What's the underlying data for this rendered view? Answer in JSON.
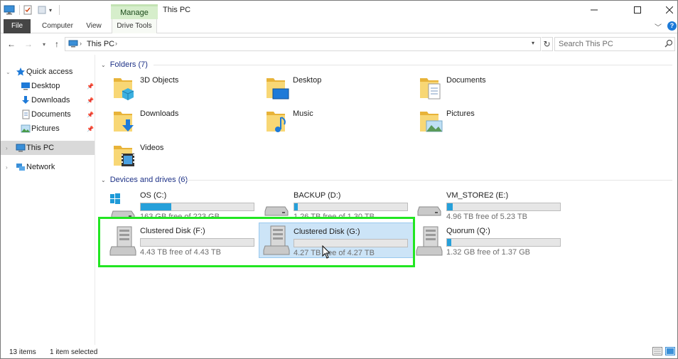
{
  "window": {
    "title": "This PC",
    "manage_tab": "Manage"
  },
  "ribbon": {
    "tabs": [
      "File",
      "Computer",
      "View",
      "Drive Tools"
    ],
    "help": "?"
  },
  "nav": {
    "breadcrumb": [
      "This PC"
    ],
    "search_placeholder": "Search This PC"
  },
  "navpane": {
    "quick_access": "Quick access",
    "quick_items": [
      {
        "label": "Desktop",
        "icon": "desktop-icon"
      },
      {
        "label": "Downloads",
        "icon": "download-icon"
      },
      {
        "label": "Documents",
        "icon": "documents-icon"
      },
      {
        "label": "Pictures",
        "icon": "pictures-icon"
      }
    ],
    "this_pc": "This PC",
    "network": "Network"
  },
  "content": {
    "folders_header": "Folders (7)",
    "folders": [
      {
        "name": "3D Objects",
        "icon": "3d-objects-folder-icon"
      },
      {
        "name": "Desktop",
        "icon": "desktop-folder-icon"
      },
      {
        "name": "Documents",
        "icon": "documents-folder-icon"
      },
      {
        "name": "Downloads",
        "icon": "downloads-folder-icon"
      },
      {
        "name": "Music",
        "icon": "music-folder-icon"
      },
      {
        "name": "Pictures",
        "icon": "pictures-folder-icon"
      },
      {
        "name": "Videos",
        "icon": "videos-folder-icon"
      }
    ],
    "drives_header": "Devices and drives (6)",
    "drives": [
      {
        "name": "OS (C:)",
        "free": "163 GB free of 223 GB",
        "used_fraction": 0.27,
        "icon": "windows-drive-icon"
      },
      {
        "name": "BACKUP (D:)",
        "free": "1.26 TB free of 1.30 TB",
        "used_fraction": 0.03,
        "icon": "hard-drive-icon"
      },
      {
        "name": "VM_STORE2 (E:)",
        "free": "4.96 TB free of 5.23 TB",
        "used_fraction": 0.05,
        "icon": "hard-drive-icon"
      },
      {
        "name": "Clustered Disk (F:)",
        "free": "4.43 TB free of 4.43 TB",
        "used_fraction": 0.0,
        "icon": "server-drive-icon"
      },
      {
        "name": "Clustered Disk (G:)",
        "free": "4.27 TB free of 4.27 TB",
        "used_fraction": 0.0,
        "icon": "server-drive-icon"
      },
      {
        "name": "Quorum (Q:)",
        "free": "1.32 GB free of 1.37 GB",
        "used_fraction": 0.04,
        "icon": "server-drive-icon"
      }
    ],
    "selected_drive": 4
  },
  "status": {
    "count": "13 items",
    "selection": "1 item selected"
  },
  "colors": {
    "accent": "#26a0da",
    "highlight": "#22e622",
    "selection": "#cce4f7"
  }
}
